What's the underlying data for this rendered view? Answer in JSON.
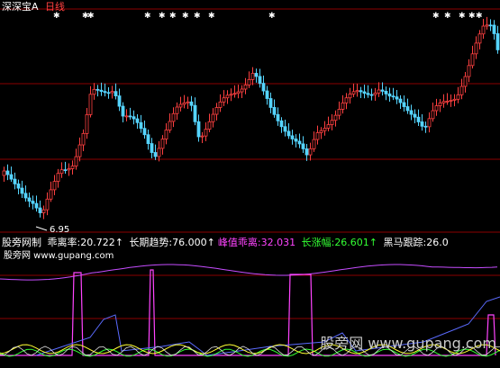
{
  "header": {
    "market_label": "深深宝A",
    "period_label": "日线"
  },
  "price_panel": {
    "low_label": "6.95"
  },
  "indicator": {
    "name": "股旁网制",
    "items": [
      {
        "label": "乖离率:",
        "value": "20.722↑",
        "color": "#ffffff"
      },
      {
        "label": "长期趋势:",
        "value": "76.000↑",
        "color": "#ffffff"
      },
      {
        "label": "峰值乖离:",
        "value": "32.031",
        "color": "#ff44ff"
      },
      {
        "label": "长涨幅:",
        "value": "26.601↑",
        "color": "#33ff33"
      },
      {
        "label": "黑马跟踪:",
        "value": "26.0",
        "color": "#ffffff"
      }
    ],
    "site_line": "股旁网 www.gupang.com"
  },
  "watermark": {
    "text": "股旁网 www.gupang.com"
  },
  "colors": {
    "up": "#ff4040",
    "down": "#55d4ff",
    "grid": "#8b0000",
    "label_white": "#ffffff",
    "purple": "#c64dff",
    "magenta": "#ff44ff",
    "green": "#33ff33",
    "yellow": "#ffff33",
    "blue": "#5b6bff"
  }
}
